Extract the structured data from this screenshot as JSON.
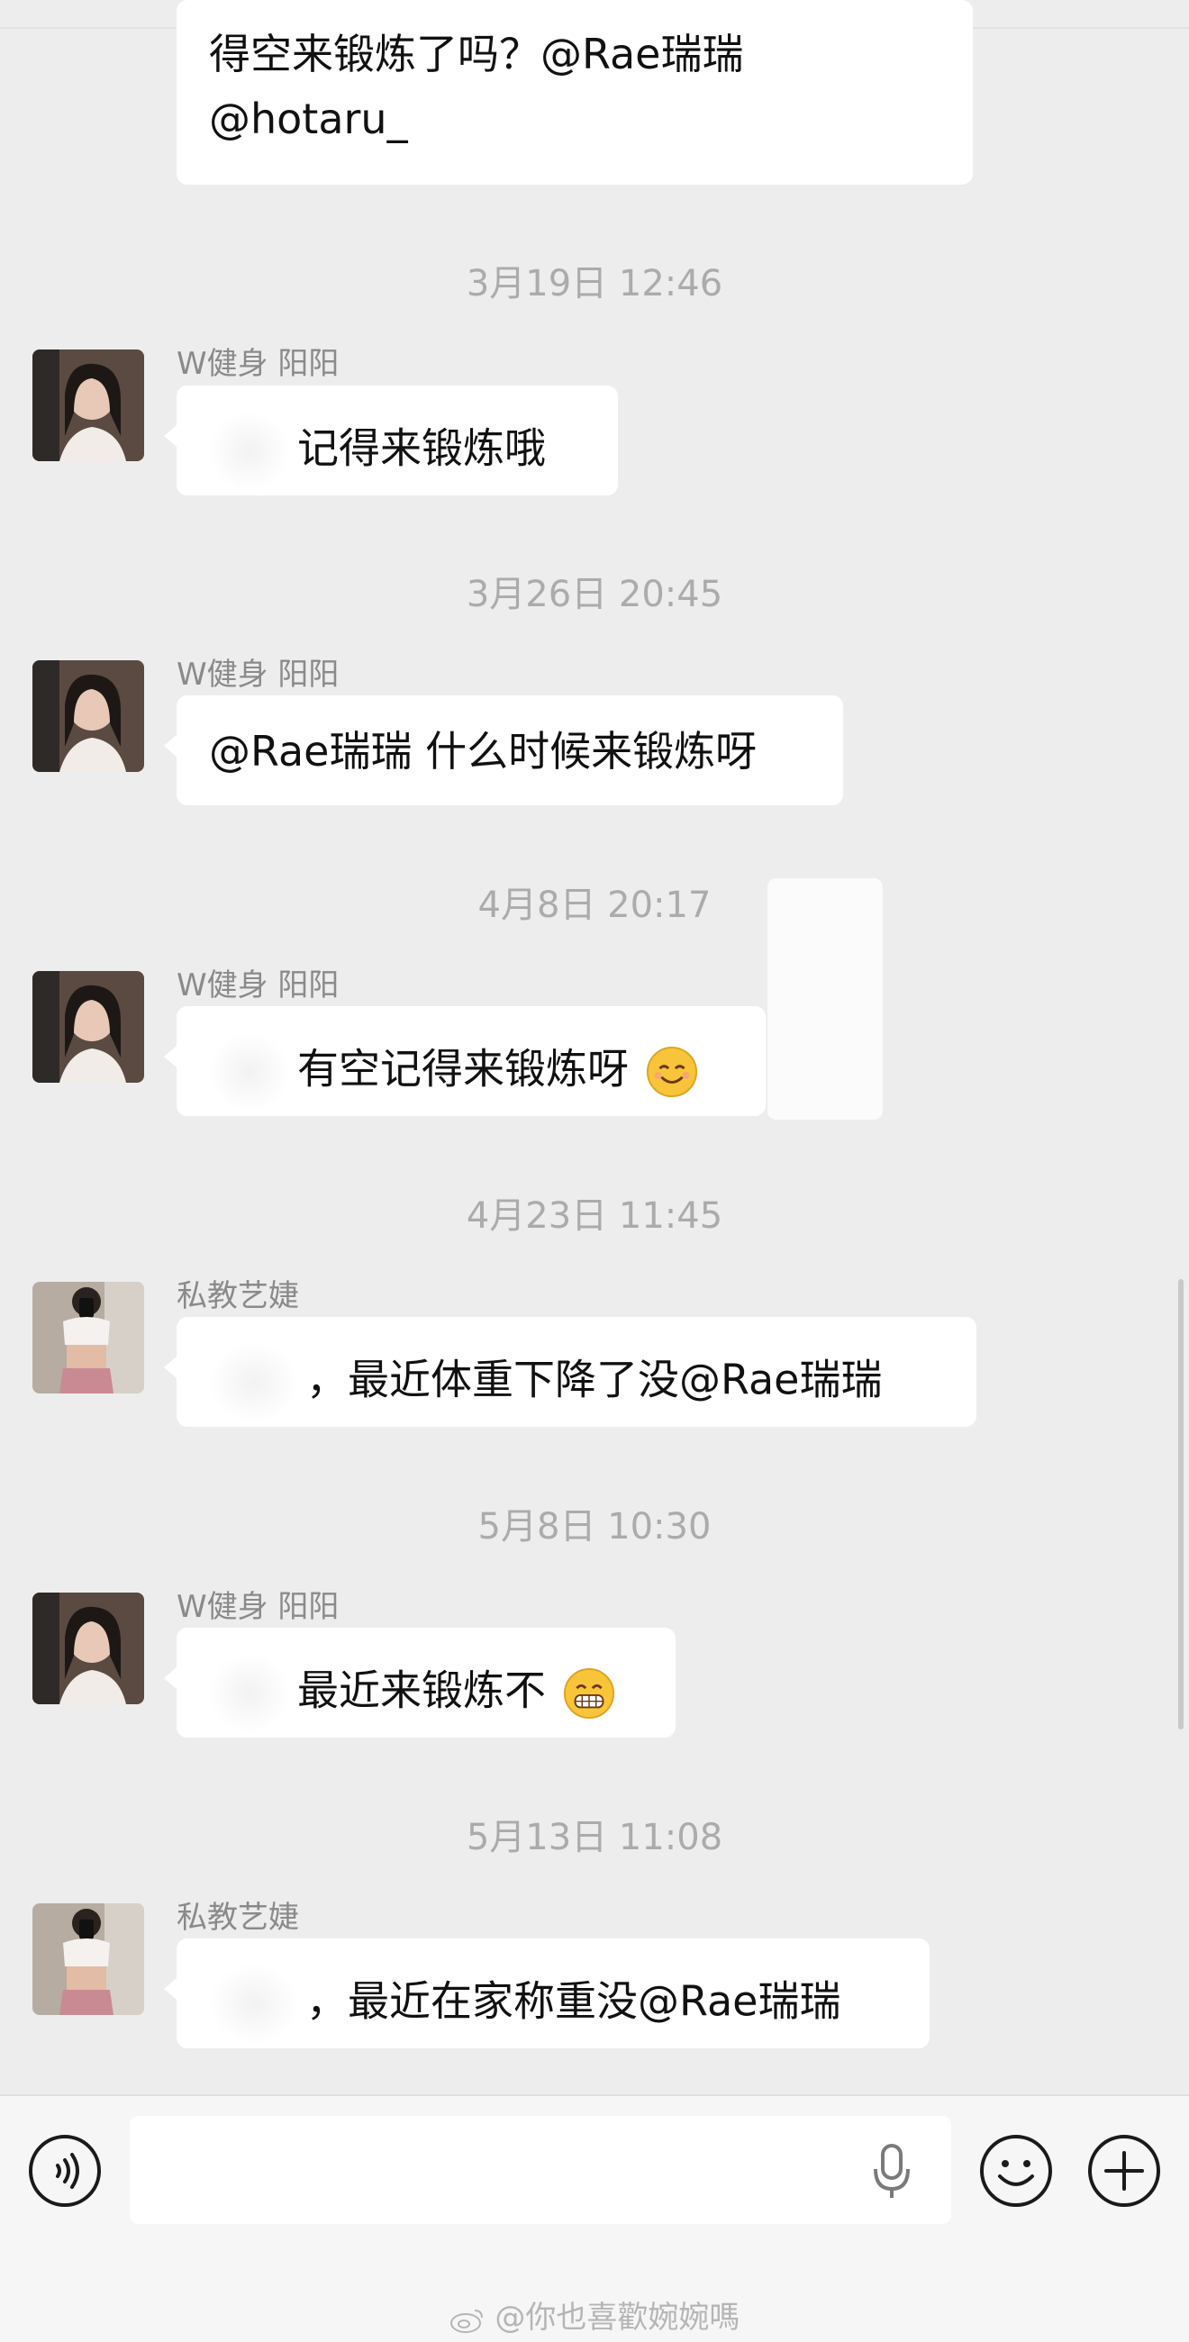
{
  "messages": [
    {
      "type": "bubble-only",
      "text_line1": "得空来锻炼了吗？@Rae瑞瑞",
      "text_line2": "@hotaru_"
    },
    {
      "time": "3月19日 12:46",
      "sender": "W健身 阳阳",
      "text": "记得来锻炼哦",
      "avatar": "avatar-yangyang"
    },
    {
      "time": "3月26日 20:45",
      "sender": "W健身 阳阳",
      "text": "@Rae瑞瑞 什么时候来锻炼呀",
      "avatar": "avatar-yangyang"
    },
    {
      "time": "4月8日 20:17",
      "sender": "W健身 阳阳",
      "text": "有空记得来锻炼呀",
      "emoji": "smiling-face-emoji",
      "avatar": "avatar-yangyang"
    },
    {
      "time": "4月23日 11:45",
      "sender": "私教艺婕",
      "text": "，最近体重下降了没@Rae瑞瑞",
      "avatar": "avatar-yijie"
    },
    {
      "time": "5月8日 10:30",
      "sender": "W健身 阳阳",
      "text": "最近来锻炼不",
      "emoji": "grinning-face-emoji",
      "avatar": "avatar-yangyang"
    },
    {
      "time": "5月13日 11:08",
      "sender": "私教艺婕",
      "text": "，最近在家称重没@Rae瑞瑞",
      "avatar": "avatar-yijie"
    }
  ],
  "toolbar": {
    "voice_icon": "voice-mode-icon",
    "mic_icon": "microphone-icon",
    "emoji_icon": "emoji-icon",
    "add_icon": "plus-icon"
  },
  "watermark": "@你也喜歡婉婉嗎",
  "colors": {
    "background": "#ededed",
    "bubble": "#ffffff",
    "timestamp": "#ababab",
    "sender": "#8a8a8a"
  }
}
